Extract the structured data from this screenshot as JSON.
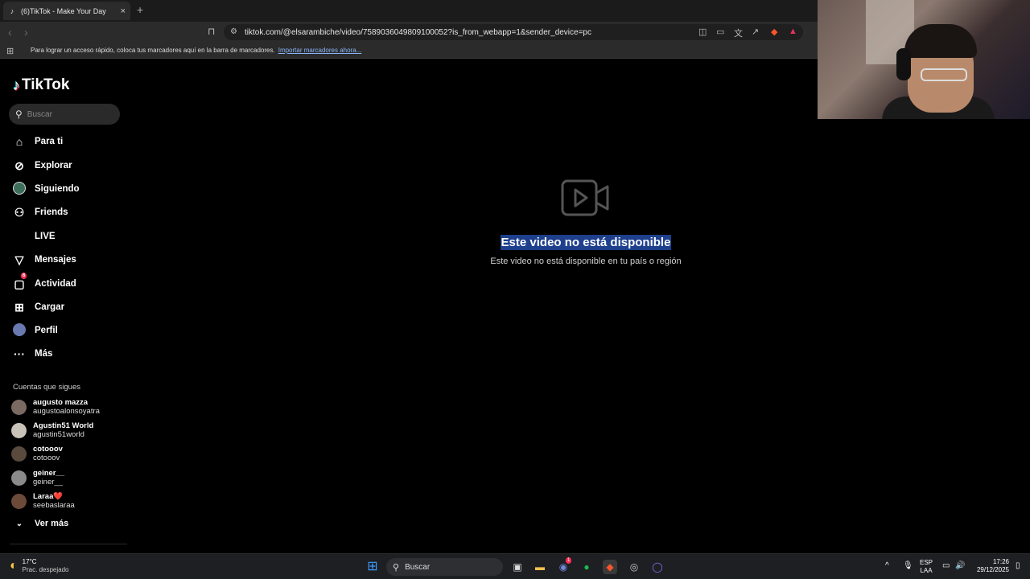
{
  "browser": {
    "tab_title": "(6)TikTok - Make Your Day",
    "tab_close": "×",
    "new_tab": "+",
    "url": "tiktok.com/@elsarambiche/video/7589036049809100052?is_from_webapp=1&sender_device=pc",
    "bookmarks_bar_text": "Para lograr un acceso rápido, coloca tus marcadores aquí en la barra de marcadores.",
    "bookmarks_import_link": "Importar marcadores ahora..."
  },
  "tiktok": {
    "logo_text": "TikTok",
    "search_placeholder": "Buscar",
    "nav": [
      {
        "label": "Para ti",
        "icon": "home-icon"
      },
      {
        "label": "Explorar",
        "icon": "compass-icon"
      },
      {
        "label": "Siguiendo",
        "icon": "following-avatar-icon"
      },
      {
        "label": "Friends",
        "icon": "friends-icon"
      },
      {
        "label": "LIVE",
        "icon": "live-icon"
      },
      {
        "label": "Mensajes",
        "icon": "messages-icon"
      },
      {
        "label": "Actividad",
        "icon": "activity-icon",
        "badge": "6"
      },
      {
        "label": "Cargar",
        "icon": "upload-icon"
      },
      {
        "label": "Perfil",
        "icon": "profile-avatar-icon"
      },
      {
        "label": "Más",
        "icon": "more-icon"
      }
    ],
    "following_title": "Cuentas que sigues",
    "following": [
      {
        "name": "augusto mazza",
        "handle": "augustoalonsoyatra",
        "color": "#7a6a62"
      },
      {
        "name": "Agustin51 World",
        "handle": "agustin51world",
        "color": "#c9c2b8"
      },
      {
        "name": "cotooov",
        "handle": "cotooov",
        "color": "#5a4a3e"
      },
      {
        "name": "geiner__",
        "handle": "geiner__",
        "color": "#8a8a8a"
      },
      {
        "name": "Laraa❤️",
        "handle": "seebaslaraa",
        "color": "#6b4a3a"
      }
    ],
    "see_more": "Ver más",
    "unavailable_title": "Este video no está disponible",
    "unavailable_subtitle": "Este video no está disponible en tu país o región"
  },
  "taskbar": {
    "weather_temp": "17°C",
    "weather_desc": "Prac. despejado",
    "search_label": "Buscar",
    "lang_top": "ESP",
    "lang_bottom": "LAA",
    "time": "17:26",
    "date": "29/12/2025",
    "discord_badge": "1"
  },
  "colors": {
    "tiktok_red": "#fe2c55",
    "tiktok_cyan": "#25f4ee",
    "selection_blue": "#1d3f8c"
  }
}
